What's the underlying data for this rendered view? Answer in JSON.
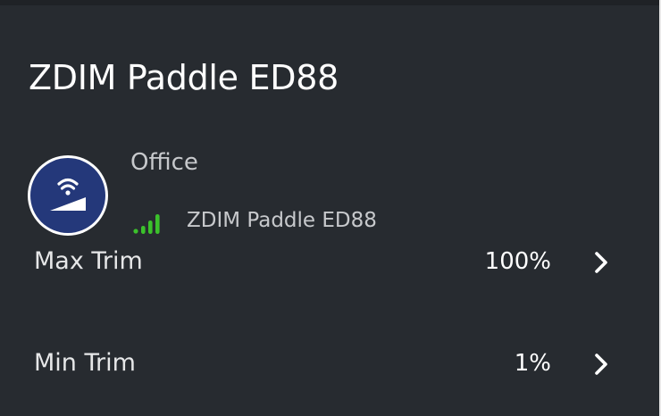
{
  "header": {
    "title": "ZDIM Paddle ED88"
  },
  "device": {
    "avatar_icon": "wireless-dimmer-icon",
    "room": "Office",
    "signal_icon": "signal-strength-icon",
    "signal_color": "#3bc12b",
    "name": "ZDIM Paddle ED88"
  },
  "settings": [
    {
      "label": "Max Trim",
      "value": "100%",
      "chevron_icon": "chevron-right-icon"
    },
    {
      "label": "Min Trim",
      "value": "1%",
      "chevron_icon": "chevron-right-icon"
    }
  ],
  "colors": {
    "background": "#272b30",
    "avatar_fill": "#24387a"
  }
}
